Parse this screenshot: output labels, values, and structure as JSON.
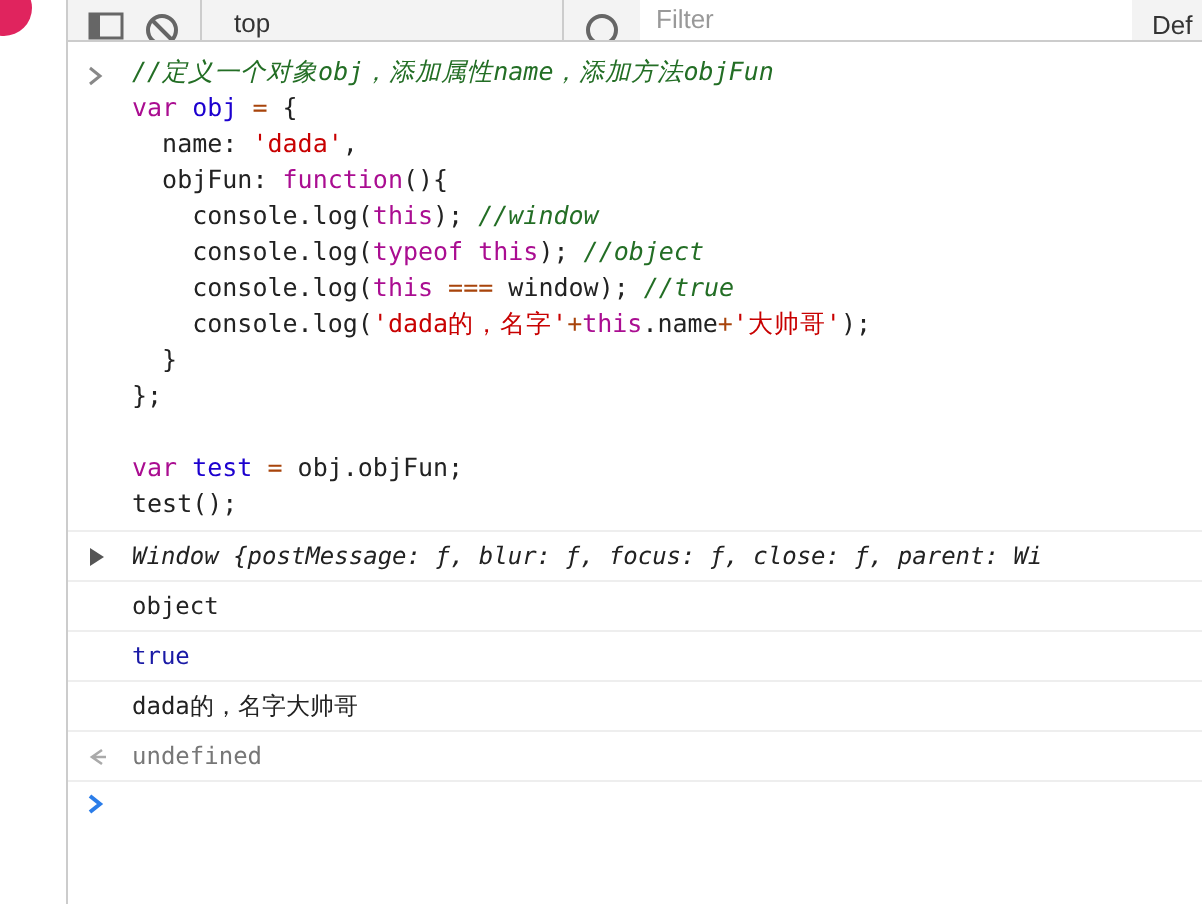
{
  "toolbar": {
    "context": "top",
    "filter": {
      "placeholder": "Filter"
    },
    "levels": "Def"
  },
  "input": {
    "blocks": [
      [
        [
          {
            "kind": "comment",
            "text": "//定义一个对象obj，添加属性name，添加方法objFun"
          }
        ],
        [
          {
            "kind": "keyword",
            "text": "var "
          },
          {
            "kind": "ident",
            "text": "obj"
          },
          {
            "kind": "op",
            "text": " = "
          },
          {
            "kind": "plain",
            "text": "{"
          }
        ],
        [
          {
            "kind": "plain",
            "text": "  name: "
          },
          {
            "kind": "string",
            "text": "'dada'"
          },
          {
            "kind": "plain",
            "text": ","
          }
        ],
        [
          {
            "kind": "plain",
            "text": "  objFun: "
          },
          {
            "kind": "keyword",
            "text": "function"
          },
          {
            "kind": "plain",
            "text": "(){"
          }
        ],
        [
          {
            "kind": "plain",
            "text": "    console.log("
          },
          {
            "kind": "keyword",
            "text": "this"
          },
          {
            "kind": "plain",
            "text": "); "
          },
          {
            "kind": "comment",
            "text": "//window"
          }
        ],
        [
          {
            "kind": "plain",
            "text": "    console.log("
          },
          {
            "kind": "keyword",
            "text": "typeof this"
          },
          {
            "kind": "plain",
            "text": "); "
          },
          {
            "kind": "comment",
            "text": "//object"
          }
        ],
        [
          {
            "kind": "plain",
            "text": "    console.log("
          },
          {
            "kind": "keyword",
            "text": "this"
          },
          {
            "kind": "op",
            "text": " === "
          },
          {
            "kind": "plain",
            "text": "window); "
          },
          {
            "kind": "comment",
            "text": "//true"
          }
        ],
        [
          {
            "kind": "plain",
            "text": "    console.log("
          },
          {
            "kind": "string",
            "text": "'dada的，名字'"
          },
          {
            "kind": "op",
            "text": "+"
          },
          {
            "kind": "keyword",
            "text": "this"
          },
          {
            "kind": "plain",
            "text": ".name"
          },
          {
            "kind": "op",
            "text": "+"
          },
          {
            "kind": "string",
            "text": "'大帅哥'"
          },
          {
            "kind": "plain",
            "text": ");"
          }
        ],
        [
          {
            "kind": "plain",
            "text": "  }"
          }
        ],
        [
          {
            "kind": "plain",
            "text": "};"
          }
        ]
      ],
      [
        [
          {
            "kind": "keyword",
            "text": "var "
          },
          {
            "kind": "ident",
            "text": "test"
          },
          {
            "kind": "op",
            "text": " = "
          },
          {
            "kind": "plain",
            "text": "obj.objFun;"
          }
        ],
        [
          {
            "kind": "plain",
            "text": "test();"
          }
        ]
      ]
    ]
  },
  "outputs": [
    {
      "kind": "object",
      "text": "Window {postMessage: ƒ, blur: ƒ, focus: ƒ, close: ƒ, parent: Wi",
      "expanded": false
    },
    {
      "kind": "log",
      "text": "object"
    },
    {
      "kind": "boolean",
      "text": "true"
    },
    {
      "kind": "log",
      "text": "dada的，名字大帅哥"
    },
    {
      "kind": "result",
      "text": "undefined"
    }
  ]
}
